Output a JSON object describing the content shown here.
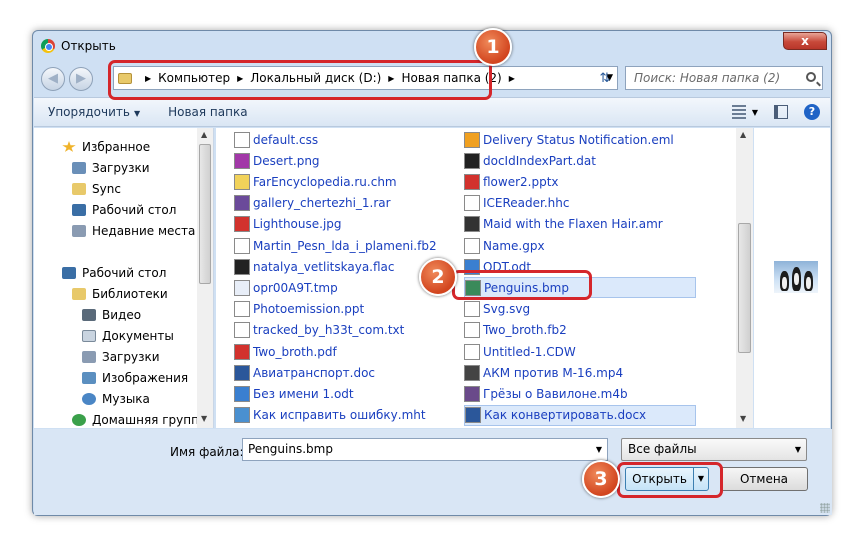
{
  "window": {
    "title": "Открыть",
    "close_glyph": "x"
  },
  "address": {
    "crumbs": [
      "Компьютер",
      "Локальный диск (D:)",
      "Новая папка (2)"
    ]
  },
  "search": {
    "placeholder": "Поиск: Новая папка (2)"
  },
  "toolbar": {
    "organize_label": "Упорядочить",
    "new_folder_label": "Новая папка"
  },
  "sidebar": {
    "items": [
      {
        "label": "Избранное",
        "icon": "star-icon",
        "color": "#f0b32a"
      },
      {
        "label": "Загрузки",
        "icon": "downloads-folder-icon",
        "color": "#6a8fb8"
      },
      {
        "label": "Sync",
        "icon": "folder-icon",
        "color": "#e8c96a"
      },
      {
        "label": "Рабочий стол",
        "icon": "desktop-icon",
        "color": "#3a6ea5"
      },
      {
        "label": "Недавние места",
        "icon": "recent-places-icon",
        "color": "#8a9bb2"
      },
      {
        "label": "Рабочий стол",
        "icon": "desktop-icon",
        "color": "#3a6ea5"
      },
      {
        "label": "Библиотеки",
        "icon": "libraries-icon",
        "color": "#e8c96a"
      },
      {
        "label": "Видео",
        "icon": "video-library-icon",
        "color": "#5a6a7a"
      },
      {
        "label": "Документы",
        "icon": "documents-library-icon",
        "color": "#c9d4e0"
      },
      {
        "label": "Загрузки",
        "icon": "downloads-library-icon",
        "color": "#8a9bb2"
      },
      {
        "label": "Изображения",
        "icon": "pictures-library-icon",
        "color": "#5b8fc0"
      },
      {
        "label": "Музыка",
        "icon": "music-library-icon",
        "color": "#4a86c5"
      },
      {
        "label": "Домашняя группа",
        "icon": "homegroup-icon",
        "color": "#3aa04a"
      }
    ]
  },
  "files": {
    "col1": [
      {
        "name": "default.css",
        "icon": "css-file-icon",
        "color": "#ffffff"
      },
      {
        "name": "Desert.png",
        "icon": "png-file-icon",
        "color": "#a238a8"
      },
      {
        "name": "FarEncyclopedia.ru.chm",
        "icon": "chm-file-icon",
        "color": "#f1d25a"
      },
      {
        "name": "gallery_chertezhi_1.rar",
        "icon": "rar-file-icon",
        "color": "#6b4a9a"
      },
      {
        "name": "Lighthouse.jpg",
        "icon": "jpg-file-icon",
        "color": "#d2322d"
      },
      {
        "name": "Martin_Pesn_lda_i_plameni.fb2",
        "icon": "fb2-file-icon",
        "color": "#ffffff"
      },
      {
        "name": "natalya_vetlitskaya.flac",
        "icon": "flac-file-icon",
        "color": "#222222"
      },
      {
        "name": "opr00A9T.tmp",
        "icon": "tmp-file-icon",
        "color": "#e8eef8"
      },
      {
        "name": "Photoemission.ppt",
        "icon": "ppt-file-icon",
        "color": "#ffffff"
      },
      {
        "name": "tracked_by_h33t_com.txt",
        "icon": "txt-file-icon",
        "color": "#ffffff"
      },
      {
        "name": "Two_broth.pdf",
        "icon": "pdf-file-icon",
        "color": "#d2322d"
      },
      {
        "name": "Авиатранспорт.doc",
        "icon": "doc-file-icon",
        "color": "#2b579a"
      },
      {
        "name": "Без имени 1.odt",
        "icon": "odt-file-icon",
        "color": "#3a7fd0"
      },
      {
        "name": "Как исправить ошибку.mht",
        "icon": "mht-file-icon",
        "color": "#4a90d0"
      }
    ],
    "col2": [
      {
        "name": "Delivery Status Notification.eml",
        "icon": "eml-file-icon",
        "color": "#f0a020"
      },
      {
        "name": "docIdIndexPart.dat",
        "icon": "dat-file-icon",
        "color": "#222222"
      },
      {
        "name": "flower2.pptx",
        "icon": "pptx-file-icon",
        "color": "#d2322d"
      },
      {
        "name": "ICEReader.hhc",
        "icon": "hhc-file-icon",
        "color": "#ffffff"
      },
      {
        "name": "Maid with the Flaxen Hair.amr",
        "icon": "amr-file-icon",
        "color": "#333333"
      },
      {
        "name": "Name.gpx",
        "icon": "gpx-file-icon",
        "color": "#ffffff"
      },
      {
        "name": "ODT.odt",
        "icon": "odt-file-icon",
        "color": "#3a7fd0"
      },
      {
        "name": "Penguins.bmp",
        "icon": "bmp-file-icon",
        "color": "#3a8a5a"
      },
      {
        "name": "Svg.svg",
        "icon": "svg-file-icon",
        "color": "#ffffff"
      },
      {
        "name": "Two_broth.fb2",
        "icon": "fb2-file-icon",
        "color": "#ffffff"
      },
      {
        "name": "Untitled-1.CDW",
        "icon": "cdw-file-icon",
        "color": "#ffffff"
      },
      {
        "name": "АКМ против М-16.mp4",
        "icon": "mp4-file-icon",
        "color": "#444444"
      },
      {
        "name": "Грёзы о Вавилоне.m4b",
        "icon": "m4b-file-icon",
        "color": "#6a4a8a"
      },
      {
        "name": "Как конвертировать.docx",
        "icon": "docx-file-icon",
        "color": "#2b579a"
      }
    ]
  },
  "bottom": {
    "filename_label": "Имя файла:",
    "filename_value": "Penguins.bmp",
    "filter_value": "Все файлы",
    "open_label": "Открыть",
    "cancel_label": "Отмена"
  },
  "annotations": {
    "badge1": "1",
    "badge2": "2",
    "badge3": "3",
    "color": "#d5262b"
  }
}
